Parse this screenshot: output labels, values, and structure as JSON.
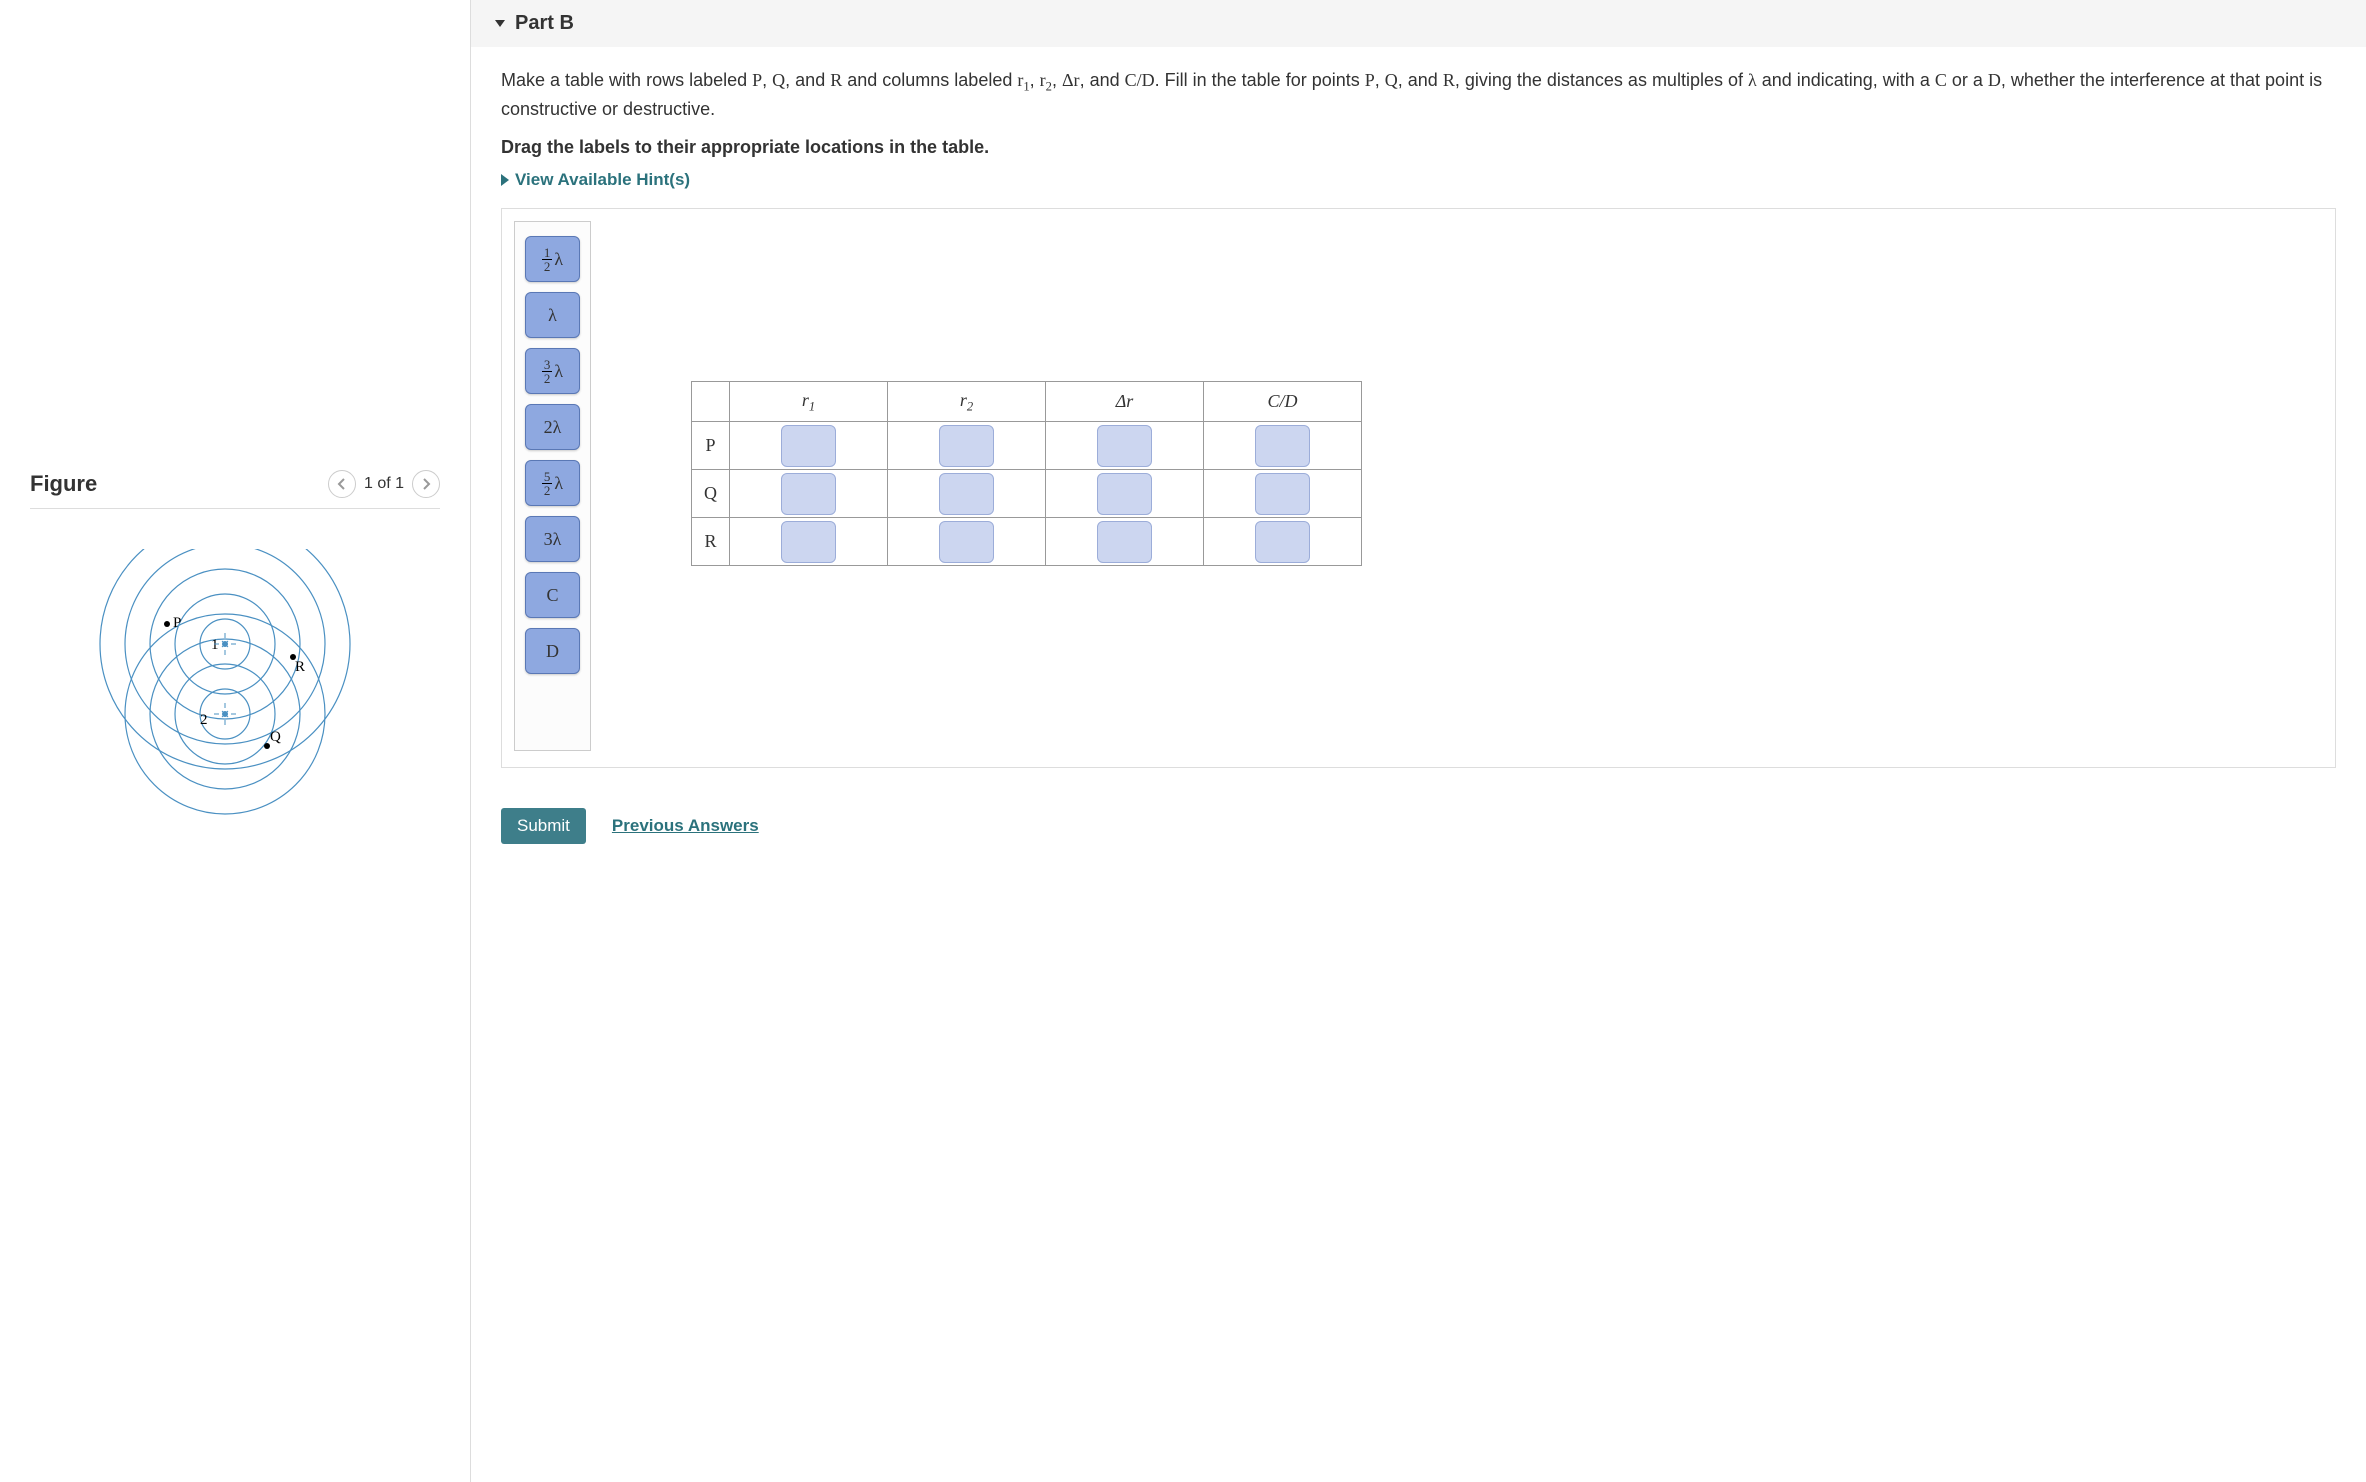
{
  "figure": {
    "title": "Figure",
    "counter": "1 of 1",
    "labels": {
      "p": "P",
      "r": "R",
      "q": "Q",
      "s1": "1",
      "s2": "2"
    }
  },
  "partB": {
    "title": "Part B",
    "instruction_html": "Make a table with rows labeled <span class='mathrm'>P</span>, <span class='mathrm'>Q</span>, and <span class='mathrm'>R</span> and columns labeled <span class='mathrm'>r<span class='sub'>1</span></span>, <span class='mathrm'>r<span class='sub'>2</span></span>, <span class='mathrm'>Δr</span>, and <span class='mathrm'>C/D</span>. Fill in the table for points <span class='mathrm'>P</span>, <span class='mathrm'>Q</span>, and <span class='mathrm'>R</span>, giving the distances as multiples of <span class='mathrm'>λ</span> and indicating, with a <span class='mathrm'>C</span> or a <span class='mathrm'>D</span>, whether the interference at that point is constructive or destructive.",
    "drag_instruction": "Drag the labels to their appropriate locations in the table.",
    "hints_label": "View Available Hint(s)",
    "labels": [
      {
        "id": "half_lambda",
        "html": "<span class='frac'><span class='num'>1</span><span class='den'>2</span></span>λ"
      },
      {
        "id": "lambda",
        "html": "λ"
      },
      {
        "id": "3half_lambda",
        "html": "<span class='frac'><span class='num'>3</span><span class='den'>2</span></span>λ"
      },
      {
        "id": "2lambda",
        "html": "2λ"
      },
      {
        "id": "5half_lambda",
        "html": "<span class='frac'><span class='num'>5</span><span class='den'>2</span></span>λ"
      },
      {
        "id": "3lambda",
        "html": "3λ"
      },
      {
        "id": "C",
        "html": "C"
      },
      {
        "id": "D",
        "html": "D"
      }
    ],
    "table": {
      "columns": [
        {
          "id": "r1",
          "html": "<span class='mathrm'>r<span class='sub'>1</span></span>"
        },
        {
          "id": "r2",
          "html": "<span class='mathrm'>r<span class='sub'>2</span></span>"
        },
        {
          "id": "dr",
          "html": "<span class='mathrm'>Δr</span>"
        },
        {
          "id": "cd",
          "html": "<span class='mathrm'>C/D</span>"
        }
      ],
      "rows": [
        {
          "id": "P",
          "label": "P"
        },
        {
          "id": "Q",
          "label": "Q"
        },
        {
          "id": "R",
          "label": "R"
        }
      ]
    },
    "submit_label": "Submit",
    "prev_answers_label": "Previous Answers"
  }
}
